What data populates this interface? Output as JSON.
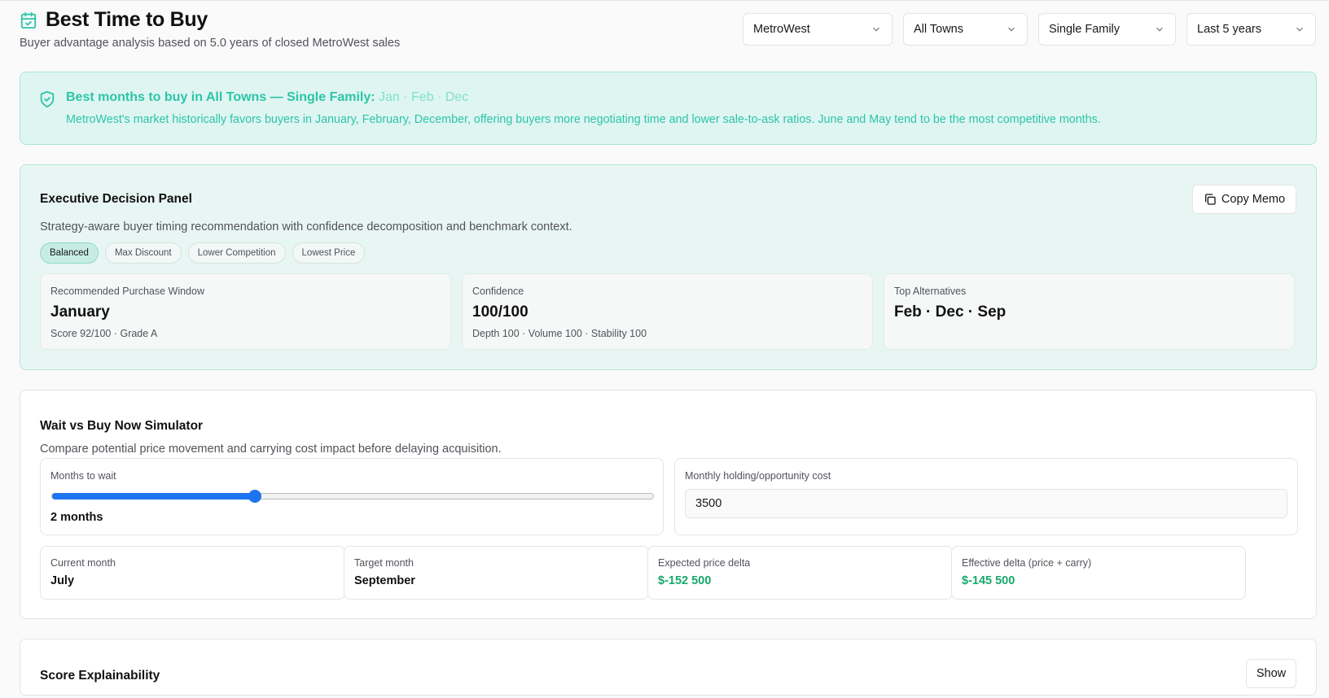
{
  "header": {
    "title": "Best Time to Buy",
    "subtitle": "Buyer advantage analysis based on 5.0 years of closed MetroWest sales",
    "icon": "calendar-check-icon"
  },
  "filters": [
    {
      "name": "region-select",
      "value": "MetroWest"
    },
    {
      "name": "town-select",
      "value": "All Towns"
    },
    {
      "name": "property-type-select",
      "value": "Single Family"
    },
    {
      "name": "period-select",
      "value": "Last 5 years"
    }
  ],
  "alert": {
    "title": "Best months to buy in All Towns — Single Family:",
    "months": "Jan · Feb · Dec",
    "text": "MetroWest's market historically favors buyers in January, February, December, offering buyers more negotiating time and lower sale-to-ask ratios. June and May tend to be the most competitive months.",
    "icon": "shield-check-icon"
  },
  "exec": {
    "title": "Executive Decision Panel",
    "copy_label": "Copy Memo",
    "description": "Strategy-aware buyer timing recommendation with confidence decomposition and benchmark context.",
    "strategies": [
      "Balanced",
      "Max Discount",
      "Lower Competition",
      "Lowest Price"
    ],
    "active_strategy": "Balanced",
    "stats": [
      {
        "label": "Recommended Purchase Window",
        "value": "January",
        "sub": "Score 92/100 · Grade A"
      },
      {
        "label": "Confidence",
        "value": "100/100",
        "sub": "Depth 100 · Volume 100 · Stability 100"
      },
      {
        "label": "Top Alternatives",
        "value": "Feb · Dec · Sep",
        "sub": ""
      }
    ]
  },
  "simulator": {
    "title": "Wait vs Buy Now Simulator",
    "description": "Compare potential price movement and carrying cost impact before delaying acquisition.",
    "wait_label": "Months to wait",
    "wait_value": "2 months",
    "wait_fraction": 0.337,
    "cost_label": "Monthly holding/opportunity cost",
    "cost_value": "3500",
    "current_month_label": "Current month",
    "current_month": "July",
    "target_month_label": "Target month",
    "target_month": "September",
    "price_delta_label": "Expected price delta",
    "price_delta": "$-152 500",
    "effective_delta_label": "Effective delta (price + carry)",
    "effective_delta": "$-145 500"
  },
  "explain": {
    "title": "Score Explainability",
    "show_label": "Show"
  },
  "colors": {
    "accent": "#2cc5a8",
    "slider": "#1e73f0",
    "positive": "#16a86c"
  }
}
